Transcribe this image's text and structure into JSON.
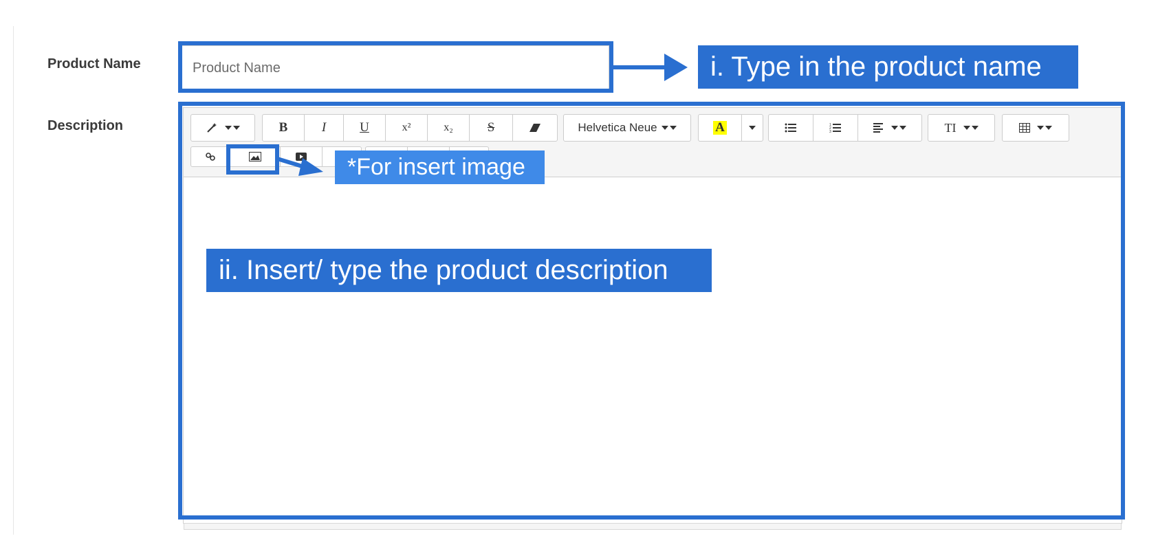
{
  "form": {
    "product_name_label": "Product Name",
    "product_name_placeholder": "Product Name",
    "description_label": "Description"
  },
  "toolbar": {
    "style_icon": "magic-wand-icon",
    "bold": "B",
    "italic": "I",
    "underline": "U",
    "superscript": "x²",
    "subscript": "x₂",
    "strikethrough": "S",
    "eraser_icon": "eraser-icon",
    "font_name": "Helvetica Neue",
    "color_letter": "A",
    "unordered_list_icon": "bullet-list-icon",
    "ordered_list_icon": "numbered-list-icon",
    "paragraph_icon": "align-left-icon",
    "font_size_icon": "TI",
    "table_icon": "table-icon",
    "link_icon": "link-icon",
    "picture_icon": "image-icon",
    "video_icon": "video-icon"
  },
  "annotations": {
    "step1": "i. Type in the product name",
    "step2": "ii. Insert/ type the product description",
    "image_note": "*For insert image",
    "accent_color": "#2a6fd0",
    "light_accent_color": "#3f8ae8"
  }
}
